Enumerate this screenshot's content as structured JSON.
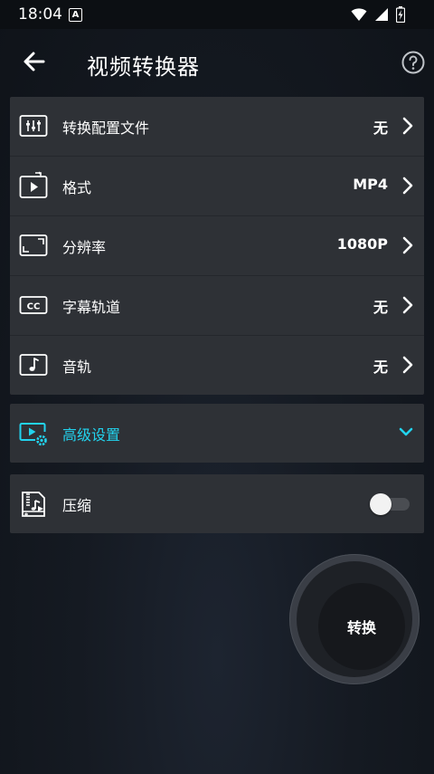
{
  "status_bar": {
    "time": "18:04",
    "notification_badge": "A"
  },
  "header": {
    "title": "视频转换器"
  },
  "settings": [
    {
      "label": "转换配置文件",
      "value": "无",
      "icon": "sliders-icon"
    },
    {
      "label": "格式",
      "value": "MP4",
      "icon": "video-format-icon"
    },
    {
      "label": "分辨率",
      "value": "1080P",
      "icon": "resolution-icon"
    },
    {
      "label": "字幕轨道",
      "value": "无",
      "icon": "subtitles-icon"
    },
    {
      "label": "音轨",
      "value": "无",
      "icon": "music-note-icon"
    }
  ],
  "advanced": {
    "label": "高级设置",
    "accent_color": "#22d3ee"
  },
  "compress": {
    "label": "压缩",
    "enabled": false
  },
  "convert_button": {
    "label": "转换"
  }
}
